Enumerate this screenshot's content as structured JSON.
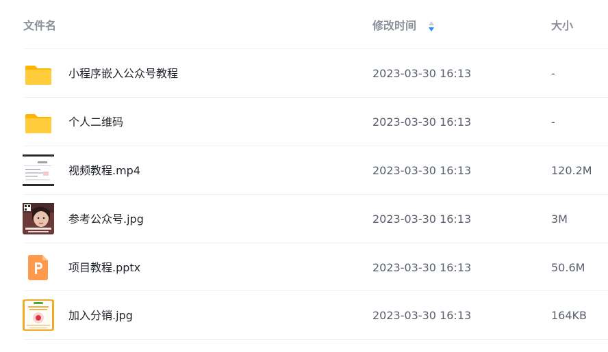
{
  "header": {
    "name_label": "文件名",
    "time_label": "修改时间",
    "size_label": "大小",
    "sort_icon": "sort-icon"
  },
  "files": [
    {
      "name": "小程序嵌入公众号教程",
      "time": "2023-03-30 16:13",
      "size": "-",
      "icon": "folder-icon"
    },
    {
      "name": "个人二维码",
      "time": "2023-03-30 16:13",
      "size": "-",
      "icon": "folder-icon"
    },
    {
      "name": "视频教程.mp4",
      "time": "2023-03-30 16:13",
      "size": "120.2M",
      "icon": "video-thumbnail"
    },
    {
      "name": "参考公众号.jpg",
      "time": "2023-03-30 16:13",
      "size": "3M",
      "icon": "image-thumbnail"
    },
    {
      "name": "项目教程.pptx",
      "time": "2023-03-30 16:13",
      "size": "50.6M",
      "icon": "pptx-icon"
    },
    {
      "name": "加入分销.jpg",
      "time": "2023-03-30 16:13",
      "size": "164KB",
      "icon": "image-thumbnail"
    }
  ],
  "colors": {
    "folder": "#ffc935",
    "pptx": "#ff9a4d",
    "sort_active": "#1890ff",
    "sort_inactive": "#c9cdd4"
  }
}
